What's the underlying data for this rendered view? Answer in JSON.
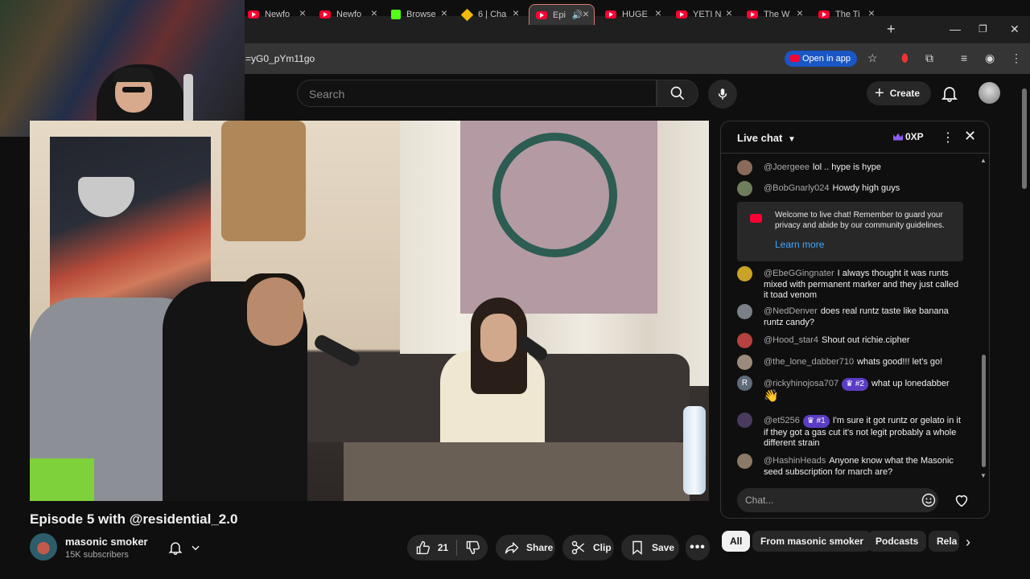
{
  "browser": {
    "tabs": [
      {
        "label": "Newfo",
        "favicon": "youtube-icon"
      },
      {
        "label": "Newfo",
        "favicon": "youtube-icon"
      },
      {
        "label": "Browse",
        "favicon": "kick-icon"
      },
      {
        "label": "6 | Cha",
        "favicon": "binance-icon"
      },
      {
        "label": "Epi",
        "favicon": "youtube-icon",
        "active": true
      },
      {
        "label": "HUGE",
        "favicon": "youtube-icon"
      },
      {
        "label": "YETI N",
        "favicon": "youtube-icon"
      },
      {
        "label": "The W",
        "favicon": "youtube-icon"
      },
      {
        "label": "The Ti",
        "favicon": "youtube-icon"
      }
    ],
    "url": "=yG0_pYm11go",
    "open_in_app": "Open in app"
  },
  "header": {
    "search_placeholder": "Search",
    "create_label": "Create"
  },
  "video": {
    "title": "Episode 5 with @residential_2.0"
  },
  "channel": {
    "name": "masonic smoker",
    "subscribers": "15K subscribers"
  },
  "actions": {
    "likes": "21",
    "share": "Share",
    "clip": "Clip",
    "save": "Save"
  },
  "chat": {
    "title": "Live chat",
    "xp": "0XP",
    "welcome_text": "Welcome to live chat! Remember to guard your privacy and abide by our community guidelines.",
    "learn_more": "Learn more",
    "input_placeholder": "Chat...",
    "messages": [
      {
        "author": "@Joergeee",
        "text": "lol .. hype is hype"
      },
      {
        "author": "@BobGnarly024",
        "text": "Howdy high guys"
      },
      {
        "author": "@EbeGGingnater",
        "text": "I always thought it was runts mixed with permanent marker and they just called it toad venom"
      },
      {
        "author": "@NedDenver",
        "text": "does real runtz taste like banana runtz candy?"
      },
      {
        "author": "@Hood_star4",
        "text": "Shout out richie.cipher"
      },
      {
        "author": "@the_lone_dabber710",
        "text": "whats good!!! let's go!"
      },
      {
        "author": "@rickyhinojosa707",
        "badge": "#2",
        "text": "what up lonedabber",
        "avatar_letter": "R"
      },
      {
        "author": "@et5256",
        "badge": "#1",
        "text": "I'm sure it got runtz or gelato in it if they got a gas cut it's not legit probably a whole different strain"
      },
      {
        "author": "@HashinHeads",
        "text": "Anyone know what the Masonic seed subscription for march are?"
      }
    ]
  },
  "chips": [
    "All",
    "From masonic smoker",
    "Podcasts",
    "Rela"
  ],
  "colors": {
    "background": "#0f0f0f",
    "youtube_red": "#ff0033",
    "link_blue": "#3ea6ff",
    "badge_purple": "#5b3cc4"
  }
}
